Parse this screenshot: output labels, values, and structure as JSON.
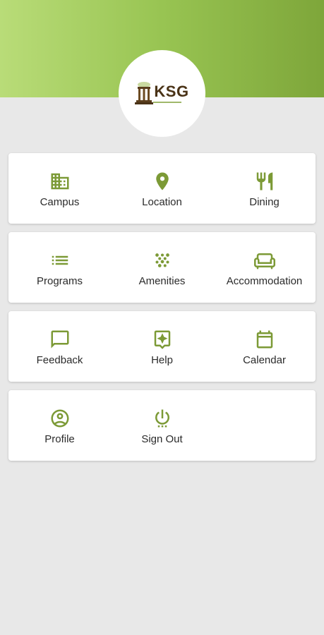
{
  "brand": {
    "logo_text": "KSG",
    "accent_color": "#7c9a36",
    "header_gradient": [
      "#b9dc78",
      "#7ea63a"
    ]
  },
  "menu": {
    "rows": [
      [
        {
          "label": "Campus",
          "icon": "building-icon"
        },
        {
          "label": "Location",
          "icon": "location-pin-icon"
        },
        {
          "label": "Dining",
          "icon": "fork-knife-icon"
        }
      ],
      [
        {
          "label": "Programs",
          "icon": "list-icon"
        },
        {
          "label": "Amenities",
          "icon": "scatter-dots-icon"
        },
        {
          "label": "Accommodation",
          "icon": "sofa-icon"
        }
      ],
      [
        {
          "label": "Feedback",
          "icon": "chat-bubble-icon"
        },
        {
          "label": "Help",
          "icon": "help-sparkle-icon"
        },
        {
          "label": "Calendar",
          "icon": "calendar-icon"
        }
      ],
      [
        {
          "label": "Profile",
          "icon": "account-circle-icon"
        },
        {
          "label": "Sign Out",
          "icon": "power-icon"
        }
      ]
    ]
  }
}
